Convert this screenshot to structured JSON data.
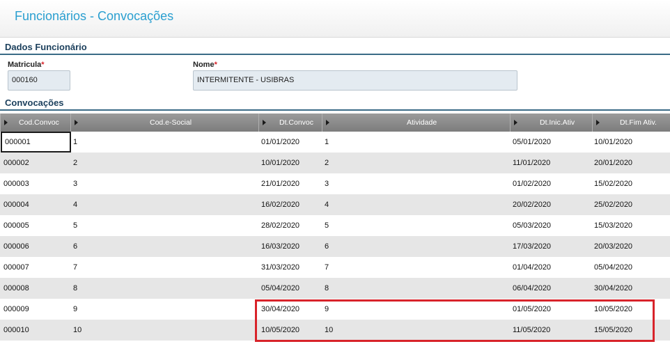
{
  "header": {
    "title": "Funcionários - Convocações"
  },
  "employee_section": {
    "title": "Dados Funcionário",
    "matricula": {
      "label": "Matricula",
      "required_mark": "*",
      "value": "000160"
    },
    "nome": {
      "label": "Nome",
      "required_mark": "*",
      "value": "INTERMITENTE - USIBRAS"
    }
  },
  "convocacoes_section": {
    "title": "Convocações"
  },
  "grid": {
    "columns": [
      "Cod.Convoc",
      "Cod.e-Social",
      "Dt.Convoc",
      "Atividade",
      "Dt.Inic.Ativ",
      "Dt.Fim Ativ."
    ],
    "rows": [
      [
        "000001",
        "1",
        "01/01/2020",
        "1",
        "05/01/2020",
        "10/01/2020"
      ],
      [
        "000002",
        "2",
        "10/01/2020",
        "2",
        "11/01/2020",
        "20/01/2020"
      ],
      [
        "000003",
        "3",
        "21/01/2020",
        "3",
        "01/02/2020",
        "15/02/2020"
      ],
      [
        "000004",
        "4",
        "16/02/2020",
        "4",
        "20/02/2020",
        "25/02/2020"
      ],
      [
        "000005",
        "5",
        "28/02/2020",
        "5",
        "05/03/2020",
        "15/03/2020"
      ],
      [
        "000006",
        "6",
        "16/03/2020",
        "6",
        "17/03/2020",
        "20/03/2020"
      ],
      [
        "000007",
        "7",
        "31/03/2020",
        "7",
        "01/04/2020",
        "05/04/2020"
      ],
      [
        "000008",
        "8",
        "05/04/2020",
        "8",
        "06/04/2020",
        "30/04/2020"
      ],
      [
        "000009",
        "9",
        "30/04/2020",
        "9",
        "01/05/2020",
        "10/05/2020"
      ],
      [
        "000010",
        "10",
        "10/05/2020",
        "10",
        "11/05/2020",
        "15/05/2020"
      ]
    ],
    "focused_row": 0,
    "highlighted_rows": [
      8,
      9
    ]
  },
  "colors": {
    "title": "#2a9fd0",
    "section": "#1b3f5c",
    "accent_line": "#3a6b86",
    "highlight": "#d8232a",
    "required": "#d8232a"
  }
}
